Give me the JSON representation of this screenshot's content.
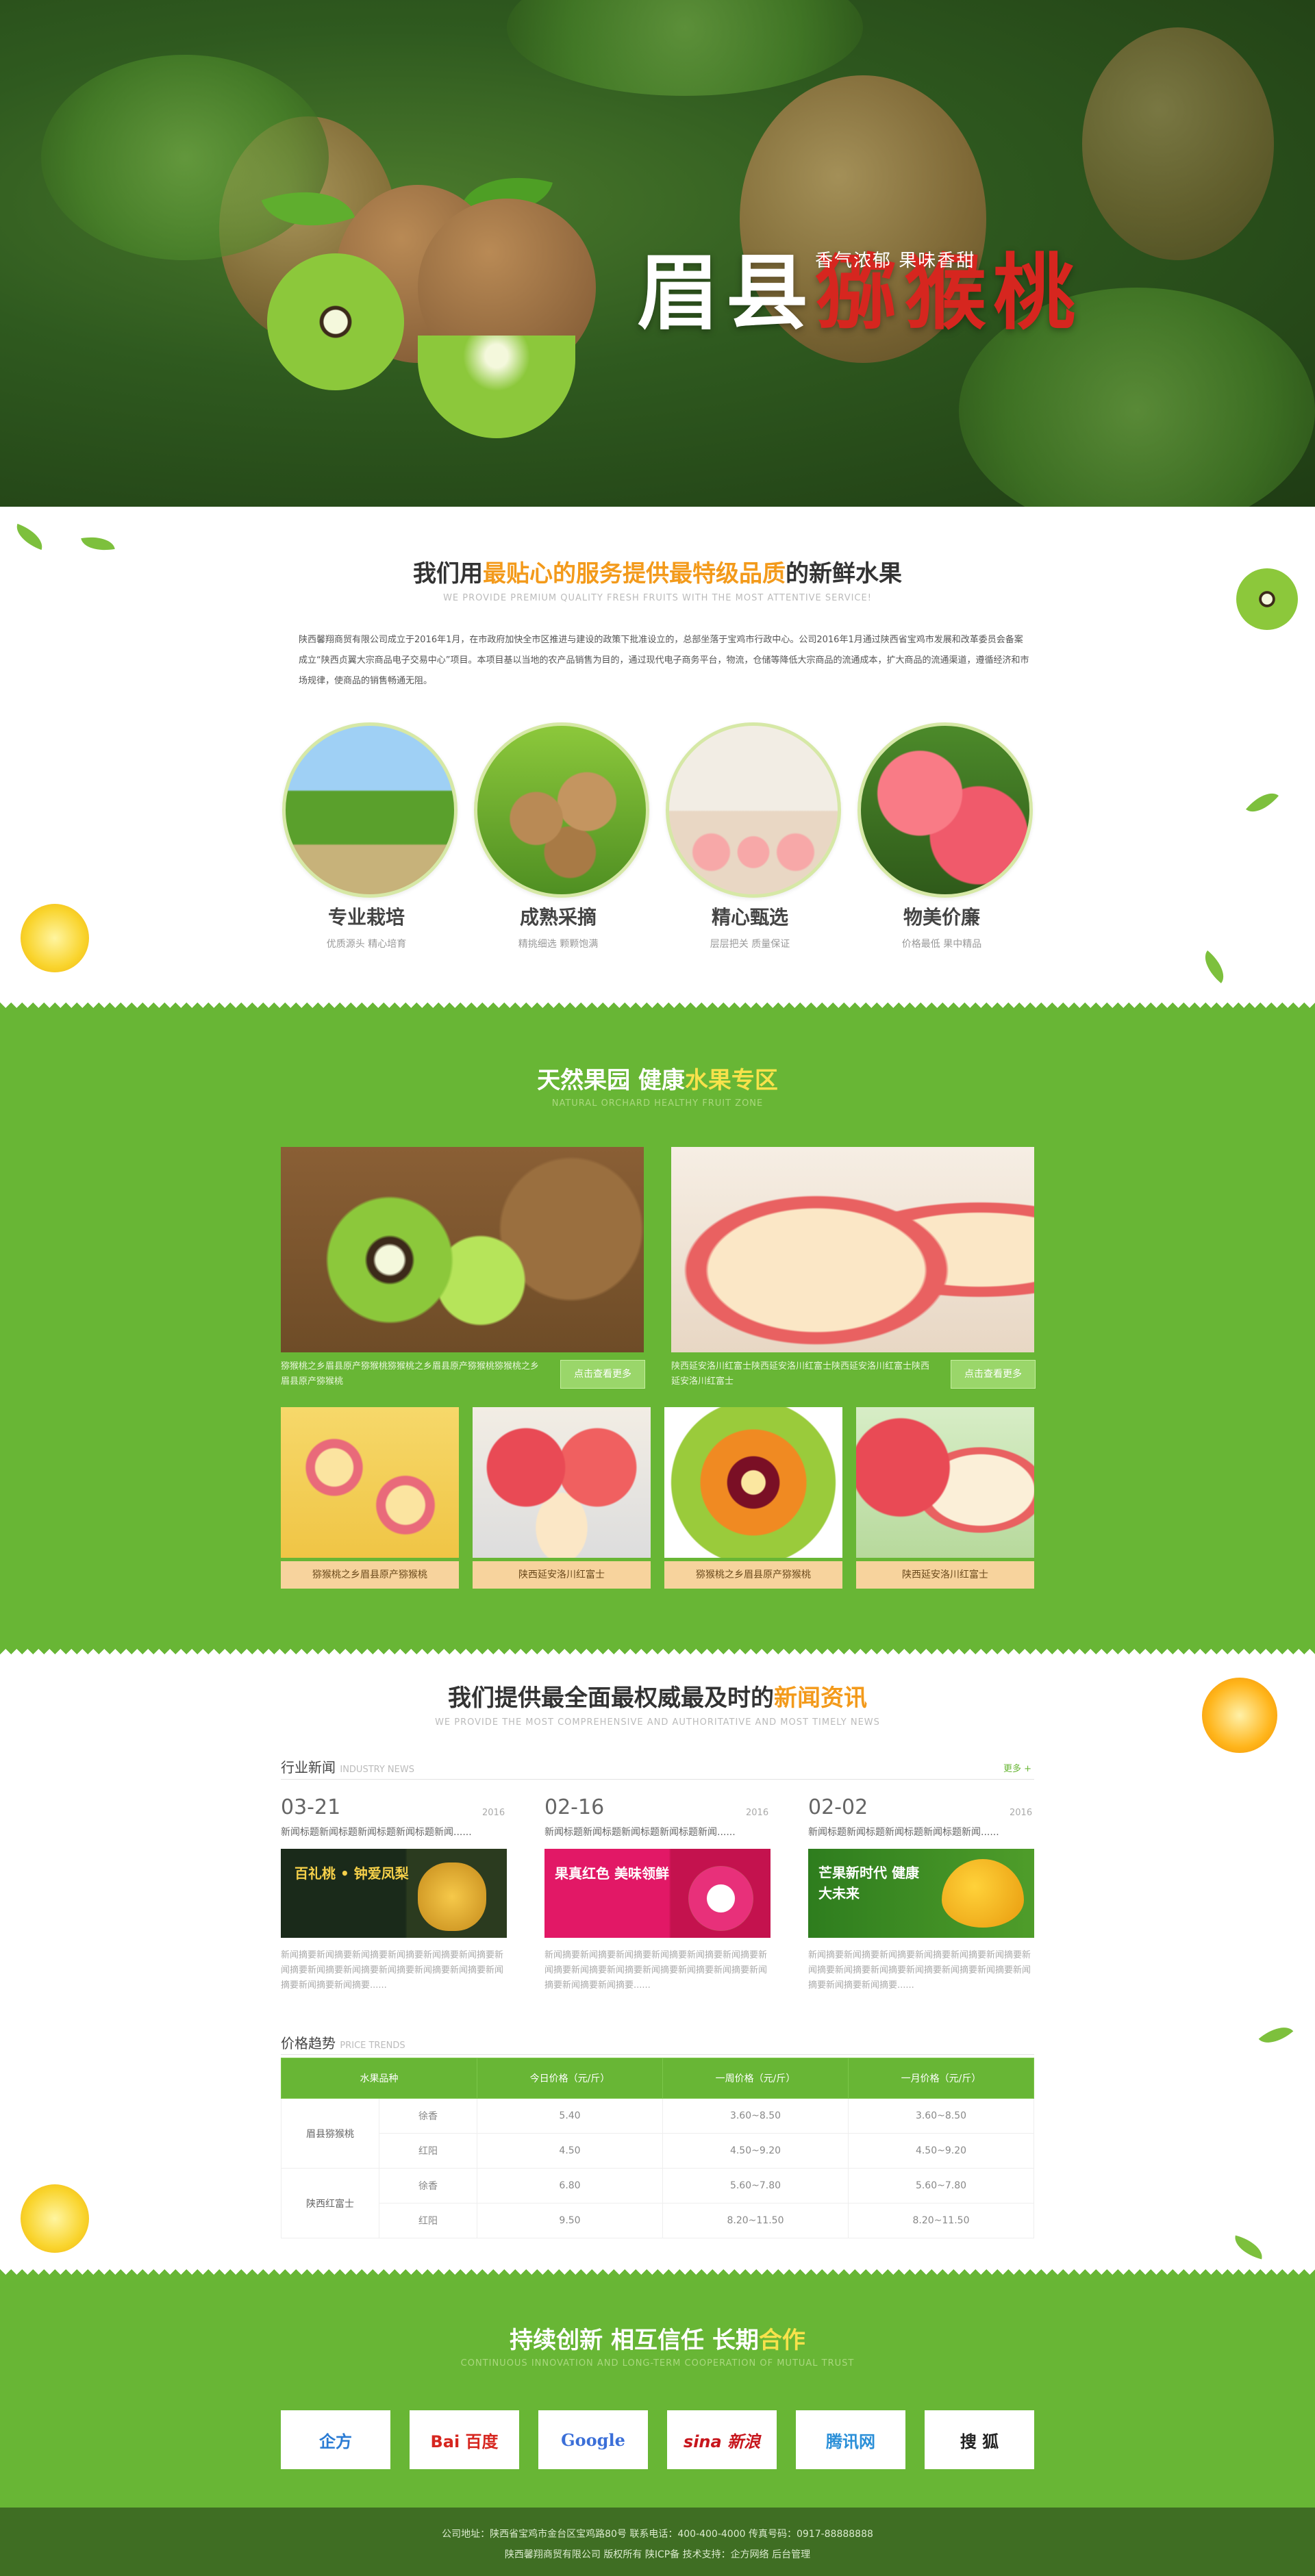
{
  "hero": {
    "title_main": "眉县",
    "title_red": "猕猴桃",
    "subtitle": "香气浓郁 果味香甜"
  },
  "intro": {
    "title_pre": "我们用",
    "title_hl": "最贴心的服务提供最特级品质",
    "title_post": "的新鲜水果",
    "subtitle": "WE PROVIDE PREMIUM QUALITY FRESH FRUITS WITH THE MOST ATTENTIVE SERVICE!",
    "paragraph": "陕西馨翔商贸有限公司成立于2016年1月，在市政府加快全市区推进与建设的政策下批准设立的，总部坐落于宝鸡市行政中心。公司2016年1月通过陕西省宝鸡市发展和改革委员会备案成立“陕西贞翼大宗商品电子交易中心”项目。本项目基以当地的农产品销售为目的，通过现代电子商务平台，物流，仓储等降低大宗商品的流通成本，扩大商品的流通渠道，遵循经济和市场规律，使商品的销售畅通无阻。",
    "features": [
      {
        "label": "专业栽培",
        "sub": "优质源头  精心培育"
      },
      {
        "label": "成熟采摘",
        "sub": "精挑细选  颗颗饱满"
      },
      {
        "label": "精心甄选",
        "sub": "层层把关  质量保证"
      },
      {
        "label": "物美价廉",
        "sub": "价格最低  果中精品"
      }
    ]
  },
  "zone": {
    "title_w": "天然果园 健康",
    "title_hl": "水果专区",
    "subtitle": "NATURAL ORCHARD HEALTHY FRUIT ZONE",
    "big": [
      {
        "desc": "猕猴桃之乡眉县原产猕猴桃猕猴桃之乡眉县原产猕猴桃猕猴桃之乡眉县原产猕猴桃",
        "more": "点击查看更多"
      },
      {
        "desc": "陕西延安洛川红富士陕西延安洛川红富士陕西延安洛川红富士陕西延安洛川红富士",
        "more": "点击查看更多"
      }
    ],
    "small": [
      "猕猴桃之乡眉县原产猕猴桃",
      "陕西延安洛川红富士",
      "猕猴桃之乡眉县原产猕猴桃",
      "陕西延安洛川红富士"
    ]
  },
  "news": {
    "title_pre": "我们提供最全面最权威最及时的",
    "title_hl": "新闻资讯",
    "subtitle": "WE PROVIDE THE MOST COMPREHENSIVE AND AUTHORITATIVE AND MOST TIMELY NEWS",
    "tab": "行业新闻",
    "tab_en": "INDUSTRY NEWS",
    "more": "更多 +",
    "items": [
      {
        "date": "03-21",
        "year": "2016",
        "head": "新闻标题新闻标题新闻标题新闻标题新闻......",
        "body": "新闻摘要新闻摘要新闻摘要新闻摘要新闻摘要新闻摘要新闻摘要新闻摘要新闻摘要新闻摘要新闻摘要新闻摘要新闻摘要新闻摘要新闻摘要......",
        "banner": "百礼桃 • 钟爱凤梨"
      },
      {
        "date": "02-16",
        "year": "2016",
        "head": "新闻标题新闻标题新闻标题新闻标题新闻......",
        "body": "新闻摘要新闻摘要新闻摘要新闻摘要新闻摘要新闻摘要新闻摘要新闻摘要新闻摘要新闻摘要新闻摘要新闻摘要新闻摘要新闻摘要新闻摘要......",
        "banner": "果真红色 美味领鲜"
      },
      {
        "date": "02-02",
        "year": "2016",
        "head": "新闻标题新闻标题新闻标题新闻标题新闻......",
        "body": "新闻摘要新闻摘要新闻摘要新闻摘要新闻摘要新闻摘要新闻摘要新闻摘要新闻摘要新闻摘要新闻摘要新闻摘要新闻摘要新闻摘要新闻摘要......",
        "banner": "芒果新时代 健康大未来"
      }
    ]
  },
  "price": {
    "tab": "价格趋势",
    "tab_en": "PRICE TRENDS",
    "headers": [
      "水果品种",
      "",
      "今日价格（元/斤）",
      "一周价格（元/斤）",
      "一月价格（元/斤）"
    ],
    "rows": [
      {
        "group": "眉县猕猴桃",
        "variety": "徐香",
        "today": "5.40",
        "week": "3.60~8.50",
        "month": "3.60~8.50"
      },
      {
        "group": "",
        "variety": "红阳",
        "today": "4.50",
        "week": "4.50~9.20",
        "month": "4.50~9.20"
      },
      {
        "group": "陕西红富士",
        "variety": "徐香",
        "today": "6.80",
        "week": "5.60~7.80",
        "month": "5.60~7.80"
      },
      {
        "group": "",
        "variety": "红阳",
        "today": "9.50",
        "week": "8.20~11.50",
        "month": "8.20~11.50"
      }
    ]
  },
  "partners": {
    "title_pre": "持续创新 相互信任 长期",
    "title_hl": "合作",
    "subtitle": "CONTINUOUS INNOVATION AND LONG-TERM COOPERATION OF MUTUAL TRUST",
    "logos": [
      "企方",
      "Bai 百度",
      "Google",
      "sina 新浪",
      "腾讯网",
      "搜 狐"
    ]
  },
  "footer": {
    "line1": "公司地址：陕西省宝鸡市金台区宝鸡路80号  联系电话：400-400-4000  传真号码：0917-88888888",
    "line2": "陕西馨翔商贸有限公司 版权所有 陕ICP备      技术支持：企方网络  后台管理"
  },
  "colors": {
    "green": "#68b635",
    "orange": "#f39a1b",
    "footer": "#3f6e23"
  }
}
